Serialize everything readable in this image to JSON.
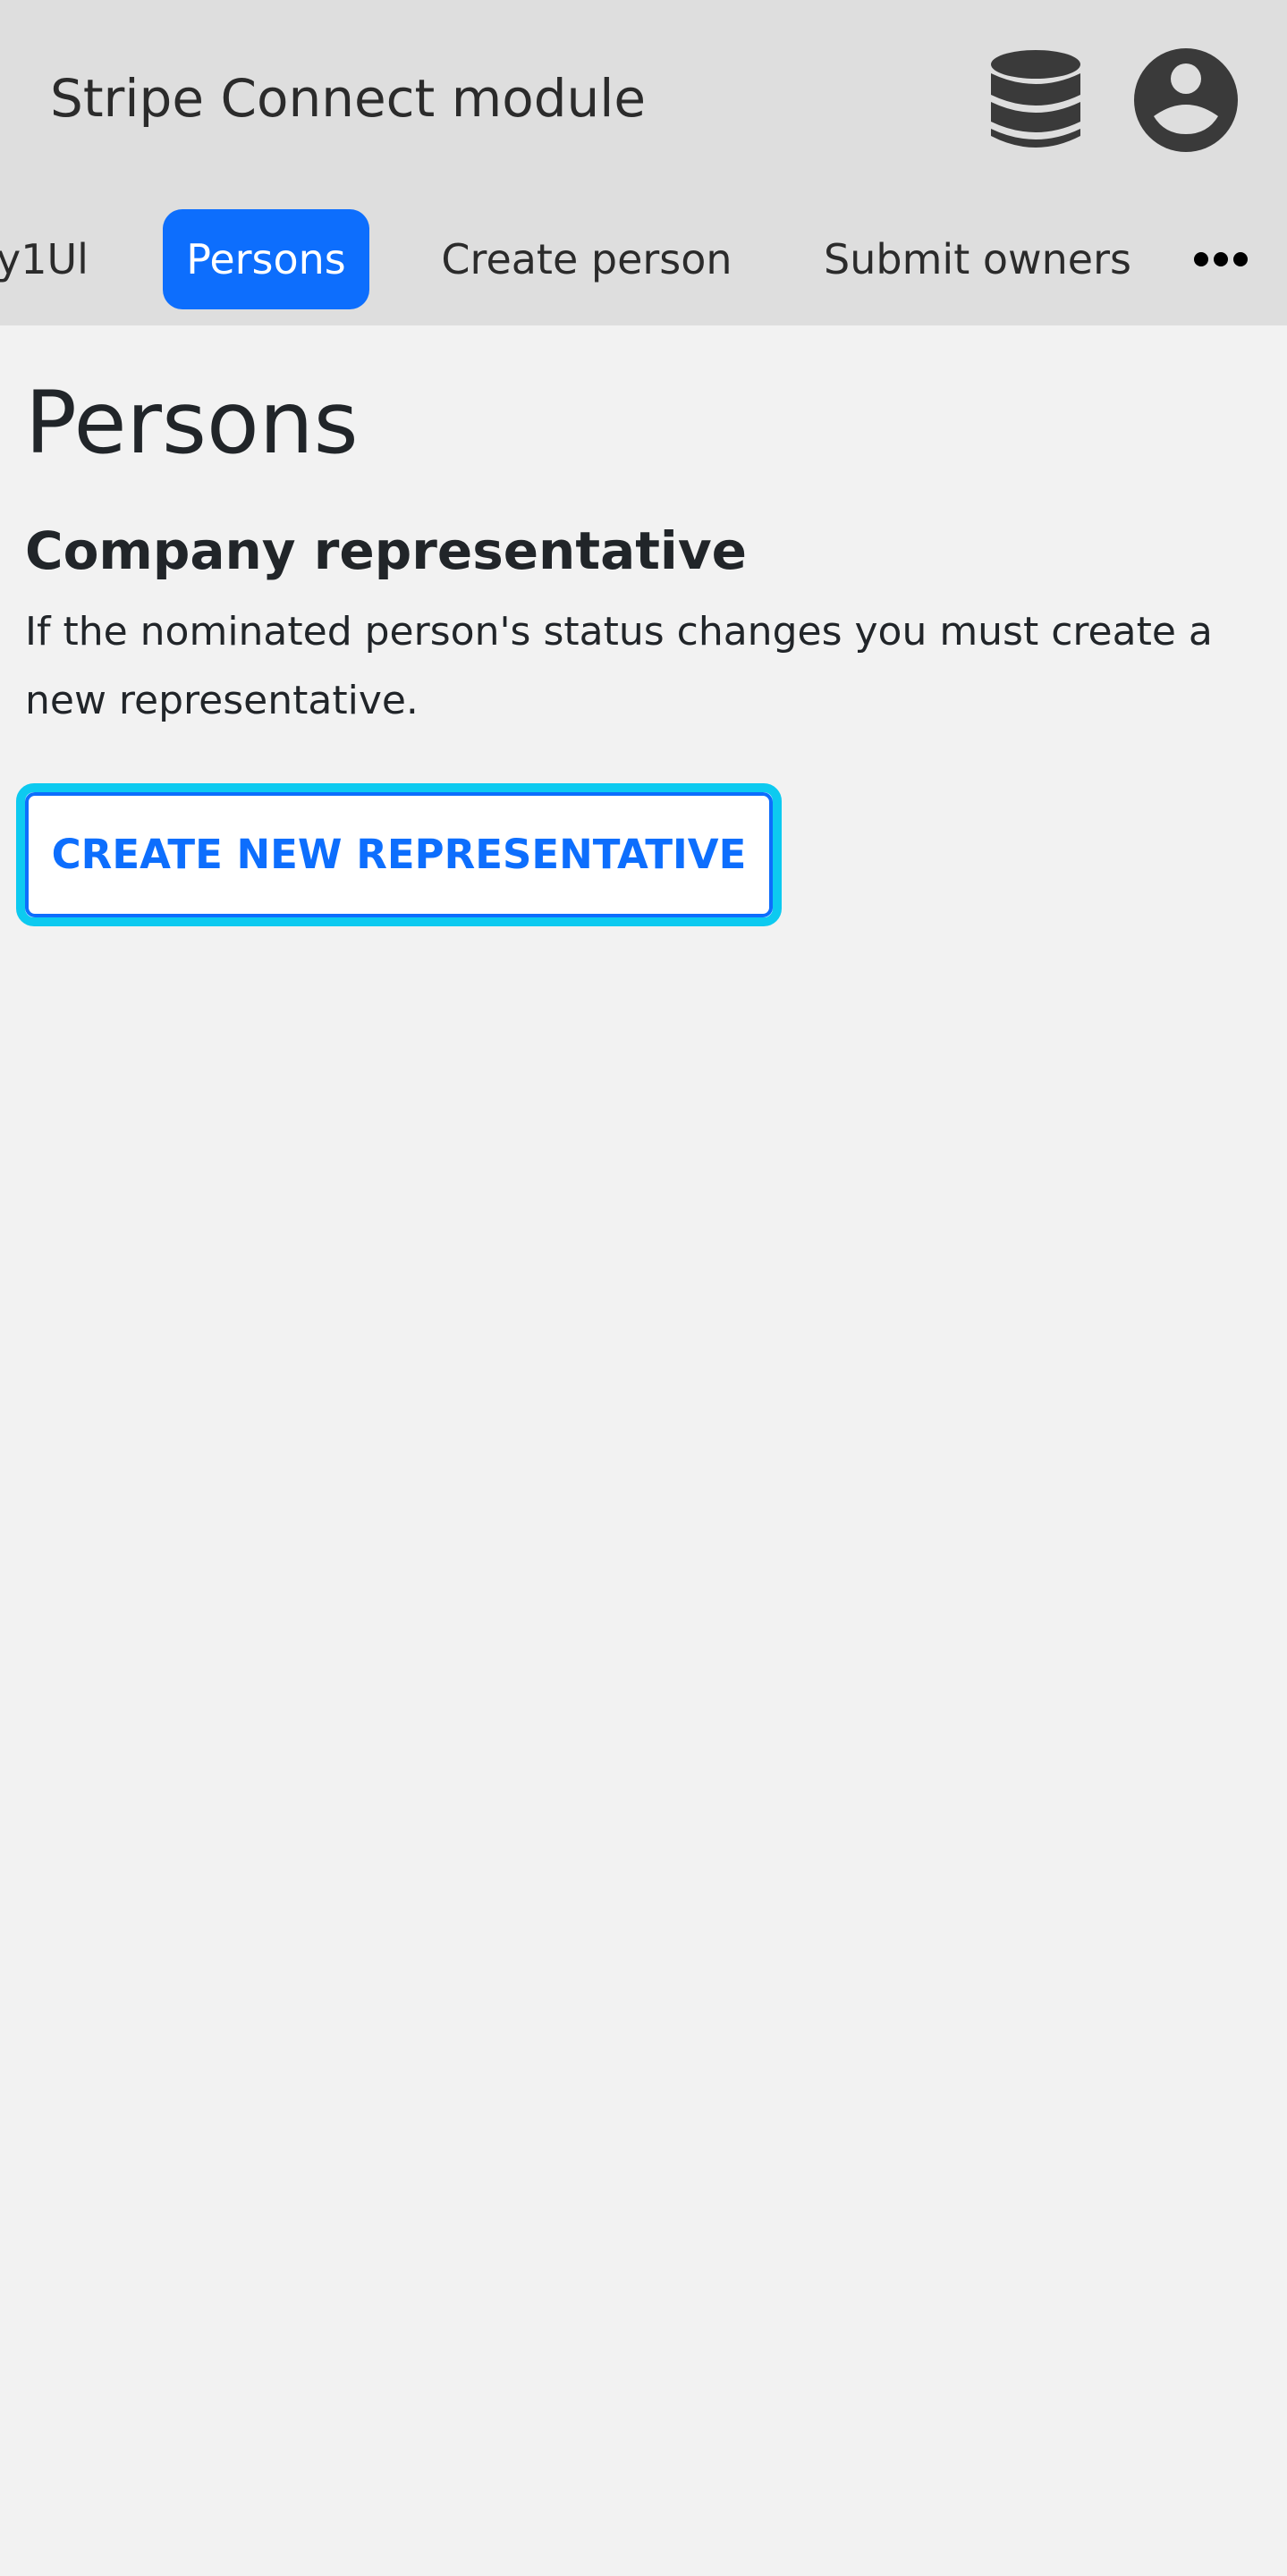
{
  "header": {
    "title": "Stripe Connect module",
    "icons": {
      "database": "database-icon",
      "account": "account-circle-icon"
    }
  },
  "tabs": [
    {
      "label": "y1Ul",
      "active": false
    },
    {
      "label": "Persons",
      "active": true
    },
    {
      "label": "Create person",
      "active": false
    },
    {
      "label": "Submit owners",
      "active": false
    }
  ],
  "more_menu_icon": "more-horizontal-icon",
  "page": {
    "title": "Persons",
    "section_title": "Company representative",
    "section_description": "If the nominated person's status changes you must create a new representative.",
    "create_button_label": "CREATE NEW REPRESENTATIVE"
  },
  "colors": {
    "header_background": "#dedede",
    "page_background": "#f2f2f2",
    "accent": "#0d6efd",
    "focus_ring": "#0dcaf0",
    "icon_dark": "#3a3a3a"
  }
}
